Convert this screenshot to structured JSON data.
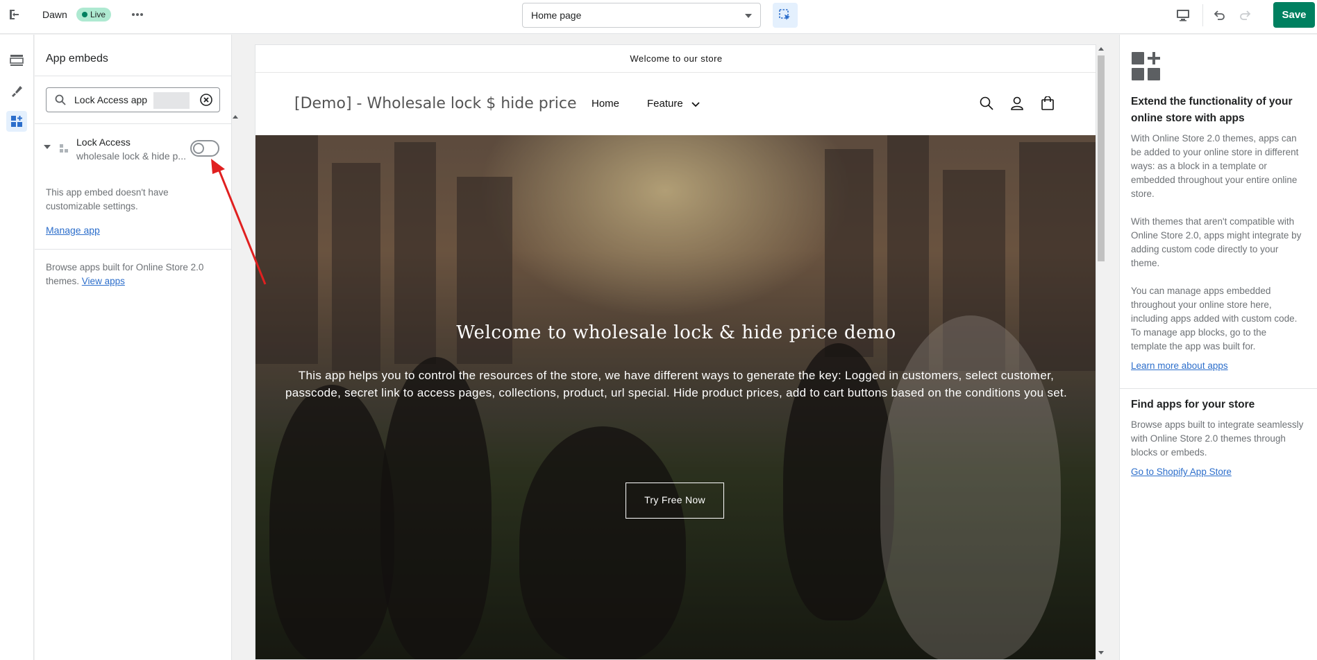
{
  "topbar": {
    "theme_name": "Dawn",
    "status_badge": "Live",
    "page_select": "Home page",
    "save_label": "Save"
  },
  "sidebar": {
    "title": "App embeds",
    "search_value": "Lock Access app",
    "app_name": "Lock Access",
    "app_description": "wholesale lock & hide p...",
    "note": "This app embed doesn't have customizable settings.",
    "manage_link": "Manage app",
    "browse_text": "Browse apps built for Online Store 2.0 themes.",
    "view_apps_link": "View apps"
  },
  "preview": {
    "announcement": "Welcome to our store",
    "store_name": "[Demo] - Wholesale lock $ hide price",
    "nav": [
      "Home",
      "Feature"
    ],
    "hero_title": "Welcome to wholesale lock & hide price demo",
    "hero_text": "This app helps you to control the resources of the store, we have different ways to generate the key: Logged in customers, select customer, passcode, secret link to access pages, collections, product, url special. Hide product prices, add to cart buttons based on the conditions you set.",
    "hero_button": "Try Free Now"
  },
  "right_panel": {
    "heading1": "Extend the functionality of your online store with apps",
    "para1": "With Online Store 2.0 themes, apps can be added to your online store in different ways: as a block in a template or embedded throughout your entire online store.",
    "para2": "With themes that aren't compatible with Online Store 2.0, apps might integrate by adding custom code directly to your theme.",
    "para3": "You can manage apps embedded throughout your online store here, including apps added with custom code. To manage app blocks, go to the template the app was built for.",
    "link1": "Learn more about apps",
    "heading2": "Find apps for your store",
    "para4": "Browse apps built to integrate seamlessly with Online Store 2.0 themes through blocks or embeds.",
    "link2": "Go to Shopify App Store"
  },
  "icons": [
    "exit-icon",
    "more-icon",
    "inspector-icon",
    "desktop-icon",
    "undo-icon",
    "redo-icon",
    "sections-icon",
    "theme-settings-icon",
    "app-embeds-icon",
    "search-icon",
    "clear-icon",
    "app-icon",
    "cart-icon",
    "account-icon",
    "apps-logo-icon"
  ],
  "colors": {
    "accent": "#008060",
    "link": "#2c6ecb",
    "badge": "#aee9d1",
    "annotation_arrow": "#e02020"
  }
}
